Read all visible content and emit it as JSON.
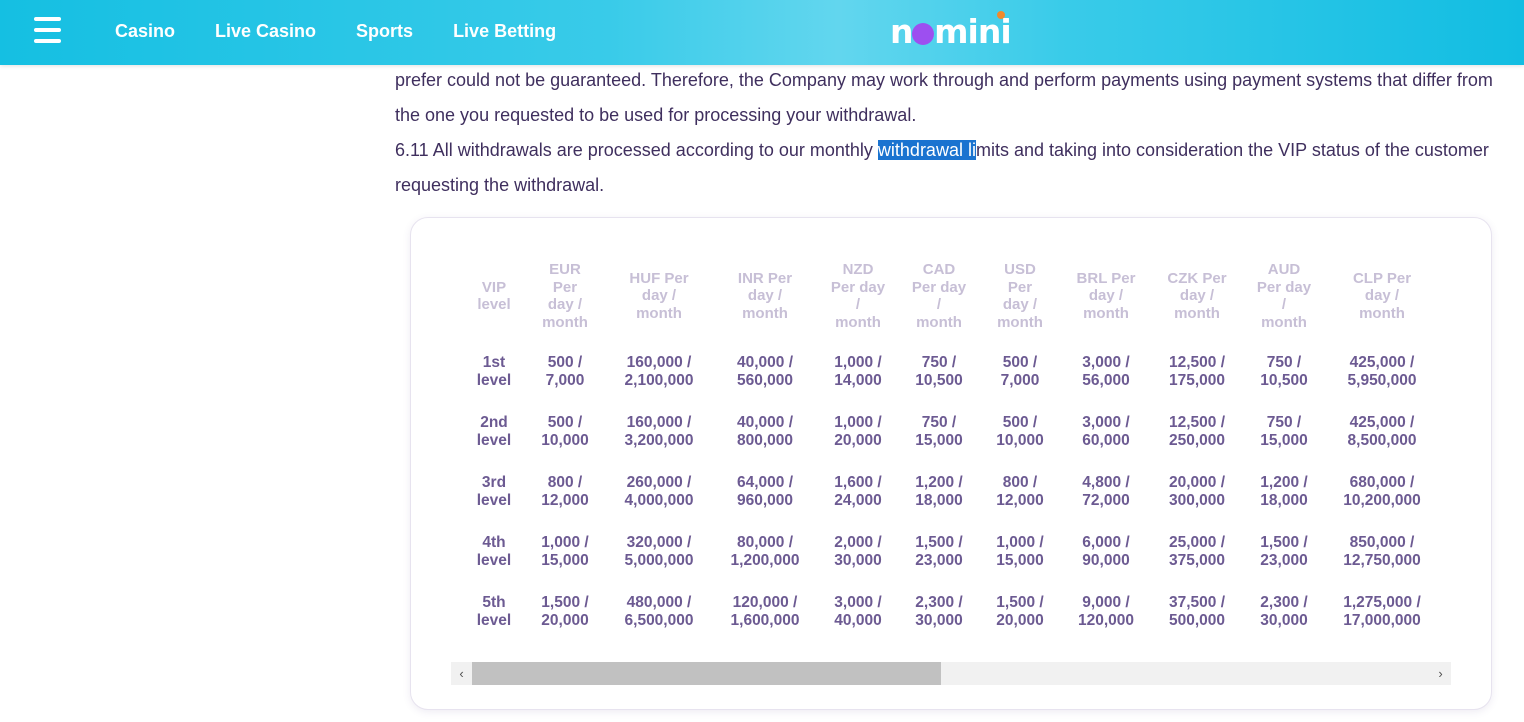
{
  "header": {
    "nav": [
      "Casino",
      "Live Casino",
      "Sports",
      "Live Betting"
    ],
    "logo_text": "nomini",
    "colors": {
      "bar": "#15bfe2",
      "logo_o": "#9d4ff0",
      "logo_dot": "#f08a2c"
    }
  },
  "content": {
    "para1": "prefer could not be guaranteed. Therefore, the Company may work through and perform payments using payment systems that differ from the one you requested to be used for processing your withdrawal.",
    "para2_before": "6.11 All withdrawals are processed according to our monthly ",
    "para2_highlight": "withdrawal li",
    "para2_after": "mits and taking into consideration the VIP status of the customer requesting the withdrawal."
  },
  "table": {
    "headers": [
      [
        "VIP",
        "level"
      ],
      [
        "EUR",
        "Per",
        "day /",
        "month"
      ],
      [
        "HUF Per",
        "day /",
        "month"
      ],
      [
        "INR Per",
        "day /",
        "month"
      ],
      [
        "NZD",
        "Per day",
        "/",
        "month"
      ],
      [
        "CAD",
        "Per day",
        "/",
        "month"
      ],
      [
        "USD",
        "Per",
        "day /",
        "month"
      ],
      [
        "BRL Per",
        "day /",
        "month"
      ],
      [
        "CZK Per",
        "day /",
        "month"
      ],
      [
        "AUD",
        "Per day",
        "/",
        "month"
      ],
      [
        "CLP Per",
        "day /",
        "month"
      ]
    ],
    "rows": [
      [
        [
          "1st",
          "level"
        ],
        [
          "500 /",
          "7,000"
        ],
        [
          "160,000 /",
          "2,100,000"
        ],
        [
          "40,000 /",
          "560,000"
        ],
        [
          "1,000 /",
          "14,000"
        ],
        [
          "750 /",
          "10,500"
        ],
        [
          "500 /",
          "7,000"
        ],
        [
          "3,000 /",
          "56,000"
        ],
        [
          "12,500 /",
          "175,000"
        ],
        [
          "750 /",
          "10,500"
        ],
        [
          "425,000 /",
          "5,950,000"
        ]
      ],
      [
        [
          "2nd",
          "level"
        ],
        [
          "500 /",
          "10,000"
        ],
        [
          "160,000 /",
          "3,200,000"
        ],
        [
          "40,000 /",
          "800,000"
        ],
        [
          "1,000 /",
          "20,000"
        ],
        [
          "750 /",
          "15,000"
        ],
        [
          "500 /",
          "10,000"
        ],
        [
          "3,000 /",
          "60,000"
        ],
        [
          "12,500 /",
          "250,000"
        ],
        [
          "750 /",
          "15,000"
        ],
        [
          "425,000 /",
          "8,500,000"
        ]
      ],
      [
        [
          "3rd",
          "level"
        ],
        [
          "800 /",
          "12,000"
        ],
        [
          "260,000 /",
          "4,000,000"
        ],
        [
          "64,000 /",
          "960,000"
        ],
        [
          "1,600 /",
          "24,000"
        ],
        [
          "1,200 /",
          "18,000"
        ],
        [
          "800 /",
          "12,000"
        ],
        [
          "4,800 /",
          "72,000"
        ],
        [
          "20,000 /",
          "300,000"
        ],
        [
          "1,200 /",
          "18,000"
        ],
        [
          "680,000 /",
          "10,200,000"
        ]
      ],
      [
        [
          "4th",
          "level"
        ],
        [
          "1,000 /",
          "15,000"
        ],
        [
          "320,000 /",
          "5,000,000"
        ],
        [
          "80,000 /",
          "1,200,000"
        ],
        [
          "2,000 /",
          "30,000"
        ],
        [
          "1,500 /",
          "23,000"
        ],
        [
          "1,000 /",
          "15,000"
        ],
        [
          "6,000 /",
          "90,000"
        ],
        [
          "25,000 /",
          "375,000"
        ],
        [
          "1,500 /",
          "23,000"
        ],
        [
          "850,000 /",
          "12,750,000"
        ]
      ],
      [
        [
          "5th",
          "level"
        ],
        [
          "1,500 /",
          "20,000"
        ],
        [
          "480,000 /",
          "6,500,000"
        ],
        [
          "120,000 /",
          "1,600,000"
        ],
        [
          "3,000 /",
          "40,000"
        ],
        [
          "2,300 /",
          "30,000"
        ],
        [
          "1,500 /",
          "20,000"
        ],
        [
          "9,000 /",
          "120,000"
        ],
        [
          "37,500 /",
          "500,000"
        ],
        [
          "2,300 /",
          "30,000"
        ],
        [
          "1,275,000 /",
          "17,000,000"
        ]
      ]
    ]
  },
  "scrollbar": {
    "left_arrow": "‹",
    "right_arrow": "›",
    "position_fraction": 0.0,
    "visible_fraction": 0.49
  }
}
